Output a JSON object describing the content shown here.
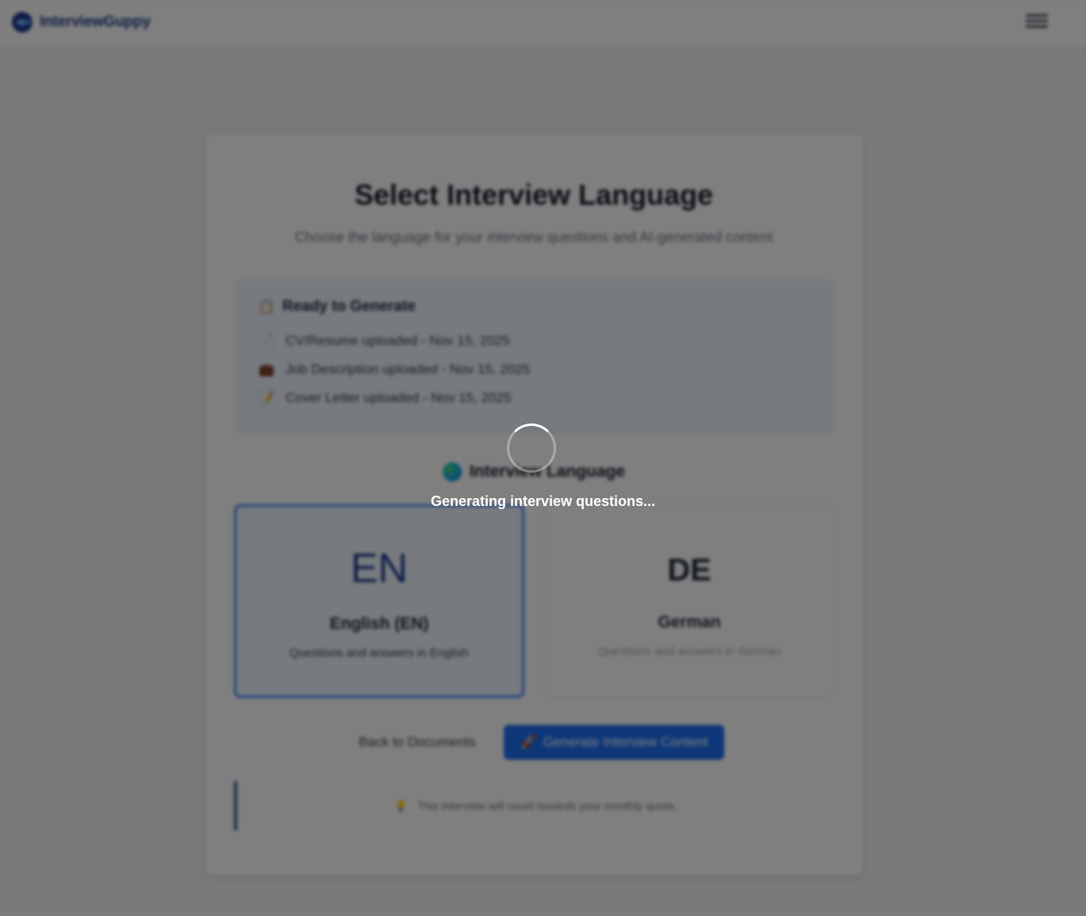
{
  "header": {
    "brand_name": "InterviewGuppy",
    "logo_icon": "fish-logo-icon",
    "menu_icon": "hamburger-menu-icon"
  },
  "card": {
    "title": "Select Interview Language",
    "subtitle": "Choose the language for your interview questions and AI-generated content"
  },
  "ready": {
    "heading": "Ready to Generate",
    "heading_icon": "clipboard-icon",
    "items": [
      {
        "icon": "document-icon",
        "label": "CV/Resume uploaded - Nov 15, 2025"
      },
      {
        "icon": "briefcase-icon",
        "label": "Job Description uploaded - Nov 15, 2025"
      },
      {
        "icon": "pencil-memo-icon",
        "label": "Cover Letter uploaded - Nov 15, 2025"
      }
    ]
  },
  "language": {
    "heading": "Interview Language",
    "heading_icon": "globe-icon",
    "options": [
      {
        "code": "EN",
        "name": "English (EN)",
        "description": "Questions and answers in English",
        "selected": true
      },
      {
        "code": "DE",
        "name": "German",
        "description": "Questions and answers in German",
        "selected": false
      }
    ]
  },
  "actions": {
    "back_label": "Back to Documents",
    "generate_label": "Generate Interview Content",
    "generate_icon": "rocket-icon"
  },
  "note": {
    "icon": "lightbulb-icon",
    "text": "This interview will count towards your monthly quota."
  },
  "overlay": {
    "loading_text": "Generating interview questions..."
  },
  "colors": {
    "accent": "#1d6ff2",
    "brand": "#1e3a8a",
    "selected_border": "#3b82f6",
    "overlay": "#000000"
  }
}
